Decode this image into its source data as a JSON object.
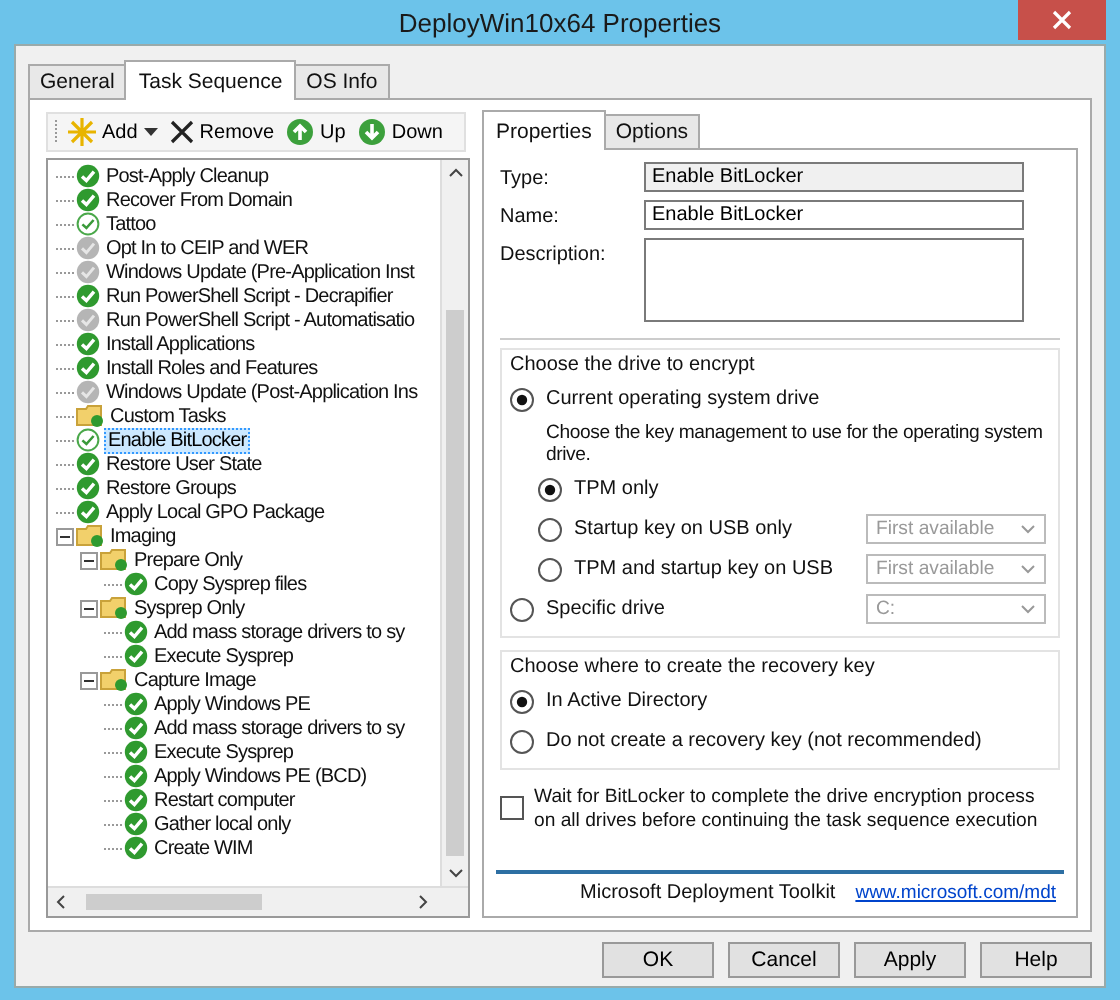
{
  "window": {
    "title": "DeployWin10x64 Properties"
  },
  "tabs": [
    {
      "label": "General",
      "selected": false
    },
    {
      "label": "Task Sequence",
      "selected": true
    },
    {
      "label": "OS Info",
      "selected": false
    }
  ],
  "toolbar": [
    {
      "label": "Add",
      "kind": "add"
    },
    {
      "label": "Remove",
      "kind": "remove"
    },
    {
      "label": "Up",
      "kind": "up"
    },
    {
      "label": "Down",
      "kind": "down"
    }
  ],
  "tree": [
    {
      "label": "Post-Apply Cleanup",
      "kind": "ok",
      "selected": false
    },
    {
      "label": "Recover From Domain",
      "kind": "ok",
      "selected": false
    },
    {
      "label": "Tattoo",
      "kind": "light",
      "selected": false
    },
    {
      "label": "Opt In to CEIP and WER",
      "kind": "off",
      "selected": false
    },
    {
      "label": "Windows Update (Pre-Application Inst",
      "kind": "off",
      "selected": false
    },
    {
      "label": "Run PowerShell Script - Decrapifier",
      "kind": "ok",
      "selected": false
    },
    {
      "label": "Run PowerShell Script - Automatisatio",
      "kind": "off",
      "selected": false
    },
    {
      "label": "Install Applications",
      "kind": "ok",
      "selected": false
    },
    {
      "label": "Install Roles and Features",
      "kind": "ok",
      "selected": false
    },
    {
      "label": "Windows Update (Post-Application Ins",
      "kind": "off",
      "selected": false
    },
    {
      "label": "Custom Tasks",
      "kind": "folder",
      "selected": false
    },
    {
      "label": "Enable BitLocker",
      "kind": "light",
      "selected": true
    },
    {
      "label": "Restore User State",
      "kind": "ok",
      "selected": false
    },
    {
      "label": "Restore Groups",
      "kind": "ok",
      "selected": false
    },
    {
      "label": "Apply Local GPO Package",
      "kind": "ok",
      "selected": false
    },
    {
      "label": "Imaging",
      "kind": "folder",
      "selected": false,
      "expanded": true,
      "children": [
        {
          "label": "Prepare Only",
          "kind": "folder",
          "selected": false,
          "expanded": true,
          "children": [
            {
              "label": "Copy Sysprep files",
              "kind": "ok",
              "selected": false
            }
          ]
        },
        {
          "label": "Sysprep Only",
          "kind": "folder",
          "selected": false,
          "expanded": true,
          "children": [
            {
              "label": "Add mass storage drivers to sy",
              "kind": "ok",
              "selected": false
            },
            {
              "label": "Execute Sysprep",
              "kind": "ok",
              "selected": false
            }
          ]
        },
        {
          "label": "Capture Image",
          "kind": "folder",
          "selected": false,
          "expanded": true,
          "children": [
            {
              "label": "Apply Windows PE",
              "kind": "ok",
              "selected": false
            },
            {
              "label": "Add mass storage drivers to sy",
              "kind": "ok",
              "selected": false
            },
            {
              "label": "Execute Sysprep",
              "kind": "ok",
              "selected": false
            },
            {
              "label": "Apply Windows PE (BCD)",
              "kind": "ok",
              "selected": false
            },
            {
              "label": "Restart computer",
              "kind": "ok",
              "selected": false
            },
            {
              "label": "Gather local only",
              "kind": "ok",
              "selected": false
            },
            {
              "label": "Create WIM",
              "kind": "ok",
              "selected": false
            }
          ]
        }
      ]
    }
  ],
  "panel": {
    "tabs": [
      {
        "label": "Properties",
        "selected": true
      },
      {
        "label": "Options",
        "selected": false
      }
    ],
    "type": {
      "label": "Type:",
      "value": "Enable BitLocker"
    },
    "name": {
      "label": "Name:",
      "value": "Enable BitLocker"
    },
    "description": {
      "label": "Description:"
    },
    "drive_group": {
      "title": "Choose the drive to encrypt",
      "options": [
        {
          "label": "Current operating system drive",
          "selected": true,
          "note": "Choose the key management to use for the operating system drive.",
          "sub_options": [
            {
              "label": "TPM only",
              "selected": true
            },
            {
              "label": "Startup key on USB only",
              "selected": false,
              "dropdown": {
                "value": "First available",
                "disabled": true
              }
            },
            {
              "label": "TPM and startup key on USB",
              "selected": false,
              "dropdown": {
                "value": "First available",
                "disabled": true
              }
            }
          ]
        },
        {
          "label": "Specific drive",
          "selected": false,
          "dropdown": {
            "value": "C:",
            "disabled": true
          }
        }
      ]
    },
    "recovery_group": {
      "title": "Choose where to create the recovery key",
      "options": [
        {
          "label": "In Active Directory",
          "selected": true
        },
        {
          "label": "Do not create a recovery key (not recommended)",
          "selected": false
        }
      ]
    },
    "wait_checkbox": {
      "label": "Wait for BitLocker to complete the drive encryption process on all drives before continuing the task sequence execution",
      "checked": false
    },
    "footer": {
      "brand": "Microsoft Deployment Toolkit",
      "link": "www.microsoft.com/mdt"
    }
  },
  "buttons": [
    "OK",
    "Cancel",
    "Apply",
    "Help"
  ]
}
